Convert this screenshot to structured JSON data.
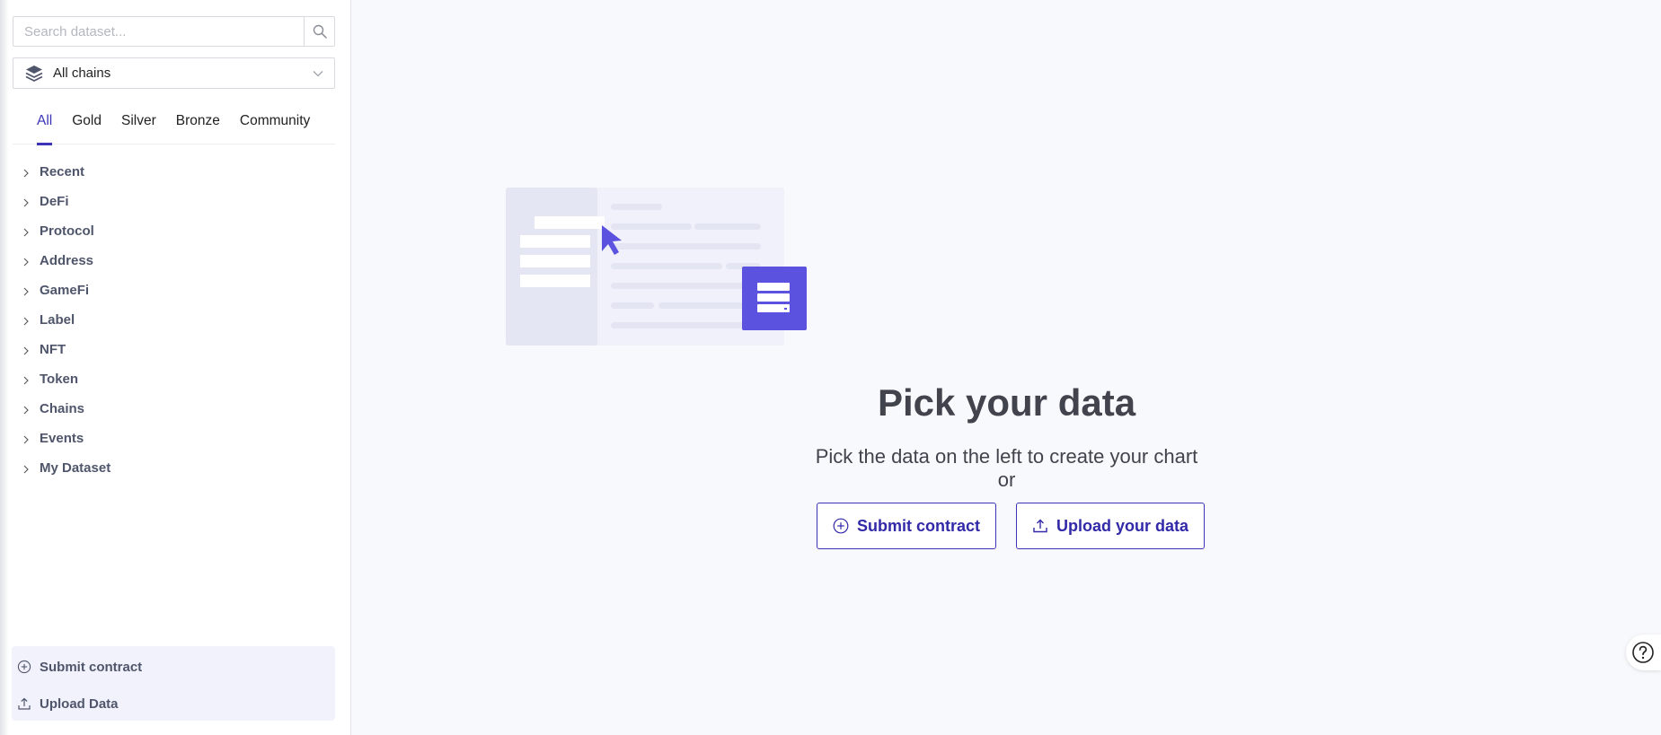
{
  "sidebar": {
    "search": {
      "placeholder": "Search dataset...",
      "value": ""
    },
    "chain_select": {
      "selected": "All chains",
      "icon": "layers-icon"
    },
    "tabs": [
      {
        "label": "All",
        "active": true
      },
      {
        "label": "Gold",
        "active": false
      },
      {
        "label": "Silver",
        "active": false
      },
      {
        "label": "Bronze",
        "active": false
      },
      {
        "label": "Community",
        "active": false
      }
    ],
    "categories": [
      "Recent",
      "DeFi",
      "Protocol",
      "Address",
      "GameFi",
      "Label",
      "NFT",
      "Token",
      "Chains",
      "Events",
      "My Dataset"
    ],
    "bottom_actions": {
      "submit_contract": "Submit contract",
      "upload_data": "Upload Data"
    }
  },
  "main": {
    "title": "Pick your data",
    "description": "Pick the data on the left to create your chart",
    "or_text": "or",
    "buttons": {
      "submit_contract": "Submit contract",
      "upload": "Upload your data"
    }
  },
  "colors": {
    "accent": "#3b34b8",
    "accent_light": "#5b52e0",
    "sidebar_bg": "#ffffff",
    "main_bg": "#f8f9fc",
    "tree_text": "#4f566b"
  }
}
